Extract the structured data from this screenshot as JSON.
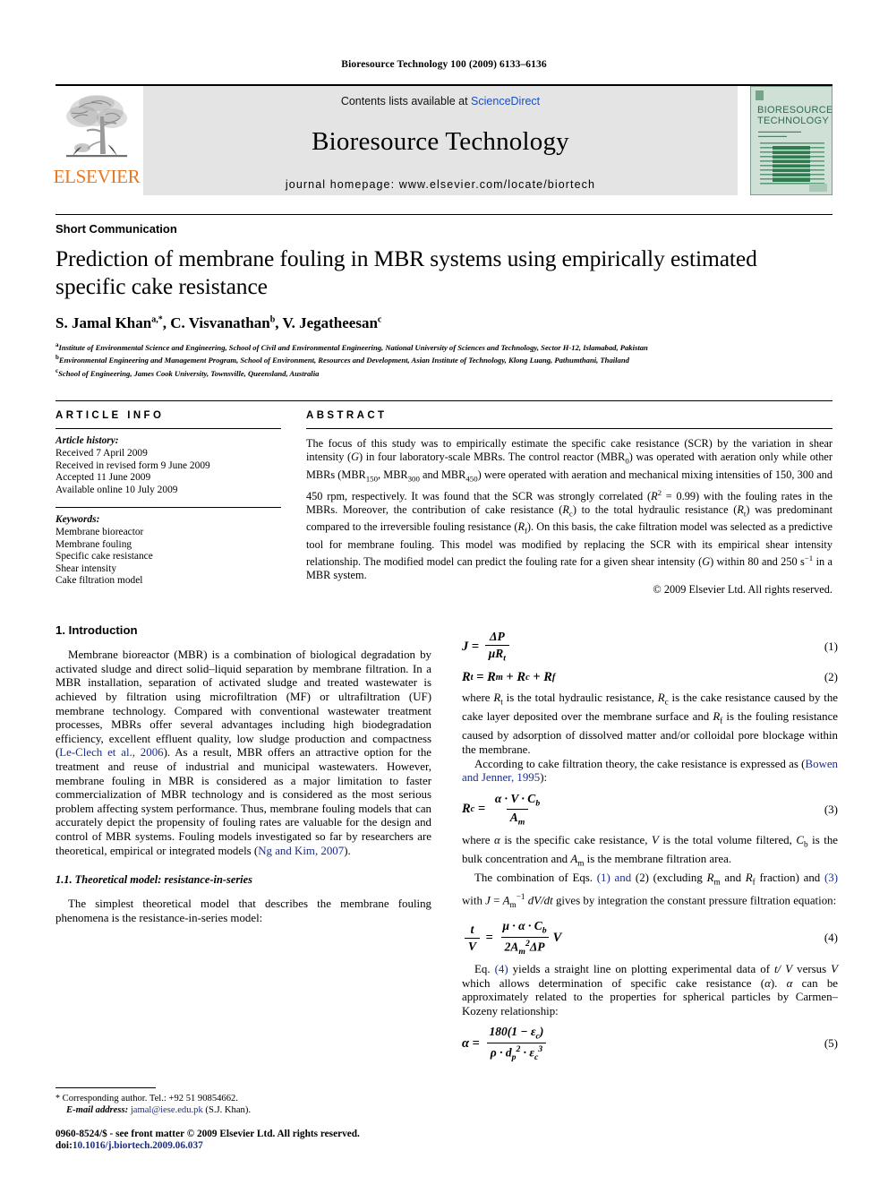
{
  "running_head": "Bioresource Technology 100 (2009) 6133–6136",
  "masthead": {
    "publisher": "ELSEVIER",
    "contents_prefix": "Contents lists available at ",
    "contents_link": "ScienceDirect",
    "journal_title": "Bioresource Technology",
    "homepage": "journal homepage: www.elsevier.com/locate/biortech",
    "cover_title_line1": "BIORESOURCE",
    "cover_title_line2": "TECHNOLOGY",
    "accent_orange": "#E87722",
    "link_blue": "#1a4fbf",
    "banner_gray": "#e4e4e4",
    "cover_green": "#cfe0d6"
  },
  "article": {
    "section_type": "Short Communication",
    "title": "Prediction of membrane fouling in MBR systems using empirically estimated specific cake resistance",
    "authors": [
      {
        "name": "S. Jamal Khan",
        "marks": "a,*"
      },
      {
        "name": "C. Visvanathan",
        "marks": "b"
      },
      {
        "name": "V. Jegatheesan",
        "marks": "c"
      }
    ],
    "affiliations": [
      {
        "mark": "a",
        "text": "Institute of Environmental Science and Engineering, School of Civil and Environmental Engineering, National University of Sciences and Technology, Sector H-12, Islamabad, Pakistan"
      },
      {
        "mark": "b",
        "text": "Environmental Engineering and Management Program, School of Environment, Resources and Development, Asian Institute of Technology, Klong Luang, Pathumthani, Thailand"
      },
      {
        "mark": "c",
        "text": "School of Engineering, James Cook University, Townsville, Queensland, Australia"
      }
    ]
  },
  "info": {
    "heading": "ARTICLE INFO",
    "history_label": "Article history:",
    "history": [
      "Received 7 April 2009",
      "Received in revised form 9 June 2009",
      "Accepted 11 June 2009",
      "Available online 10 July 2009"
    ],
    "keywords_label": "Keywords:",
    "keywords": [
      "Membrane bioreactor",
      "Membrane fouling",
      "Specific cake resistance",
      "Shear intensity",
      "Cake filtration model"
    ]
  },
  "abstract": {
    "heading": "ABSTRACT",
    "copyright": "© 2009 Elsevier Ltd. All rights reserved."
  },
  "sections": {
    "intro_heading": "1. Introduction",
    "subsection_heading": "1.1. Theoretical model: resistance-in-series",
    "ref_leclech": "Le-Clech et al., 2006",
    "ref_ngkim": "Ng and Kim, 2007",
    "ref_bowen": "Bowen and Jenner, 1995"
  },
  "equations": {
    "n1": "(1)",
    "n2": "(2)",
    "n3": "(3)",
    "n4": "(4)",
    "n5": "(5)"
  },
  "footnote": {
    "corresponding": "Corresponding author. Tel.: +92 51 90854662.",
    "email_label": "E-mail address:",
    "email": "jamal@iese.edu.pk",
    "email_owner": "(S.J. Khan).",
    "issn_line": "0960-8524/$ - see front matter © 2009 Elsevier Ltd. All rights reserved.",
    "doi_label": "doi:",
    "doi": "10.1016/j.biortech.2009.06.037"
  }
}
